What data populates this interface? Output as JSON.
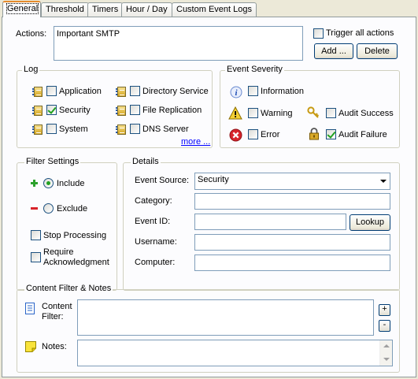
{
  "tabs": [
    {
      "label": "General"
    },
    {
      "label": "Threshold"
    },
    {
      "label": "Timers"
    },
    {
      "label": "Hour / Day"
    },
    {
      "label": "Custom Event Logs"
    }
  ],
  "actions": {
    "label": "Actions:",
    "value": "Important SMTP",
    "trigger_all_label": "Trigger all actions",
    "trigger_all_checked": false,
    "add_label": "Add ...",
    "delete_label": "Delete"
  },
  "log": {
    "title": "Log",
    "items": [
      {
        "label": "Application",
        "checked": false
      },
      {
        "label": "Security",
        "checked": true
      },
      {
        "label": "System",
        "checked": false
      },
      {
        "label": "Directory Service",
        "checked": false
      },
      {
        "label": "File Replication",
        "checked": false
      },
      {
        "label": "DNS Server",
        "checked": false
      }
    ],
    "more_label": "more ..."
  },
  "severity": {
    "title": "Event Severity",
    "items": [
      {
        "label": "Information",
        "checked": false,
        "icon": "information-icon"
      },
      {
        "label": "Warning",
        "checked": false,
        "icon": "warning-icon"
      },
      {
        "label": "Error",
        "checked": false,
        "icon": "error-icon"
      },
      {
        "label": "Audit Success",
        "checked": false,
        "icon": "key-icon"
      },
      {
        "label": "Audit Failure",
        "checked": true,
        "icon": "lock-icon"
      }
    ]
  },
  "filter": {
    "title": "Filter Settings",
    "include_label": "Include",
    "exclude_label": "Exclude",
    "selected": "include",
    "stop_label": "Stop Processing",
    "stop_checked": false,
    "require_label_line1": "Require",
    "require_label_line2": "Acknowledgment",
    "require_checked": false
  },
  "details": {
    "title": "Details",
    "source_label": "Event Source:",
    "source_value": "Security",
    "category_label": "Category:",
    "category_value": "",
    "eventid_label": "Event ID:",
    "eventid_value": "",
    "lookup_label": "Lookup",
    "username_label": "Username:",
    "username_value": "",
    "computer_label": "Computer:",
    "computer_value": ""
  },
  "content": {
    "title": "Content Filter & Notes",
    "filter_label_line1": "Content",
    "filter_label_line2": "Filter:",
    "filter_value": "",
    "notes_label": "Notes:",
    "notes_value": "",
    "plus_label": "+",
    "minus_label": "-"
  },
  "colors": {
    "panel": "#fcfcfe",
    "window": "#ece9d8",
    "link": "#0000ff",
    "active_tab_accent": "#e68b2c",
    "check": "#21a121"
  }
}
